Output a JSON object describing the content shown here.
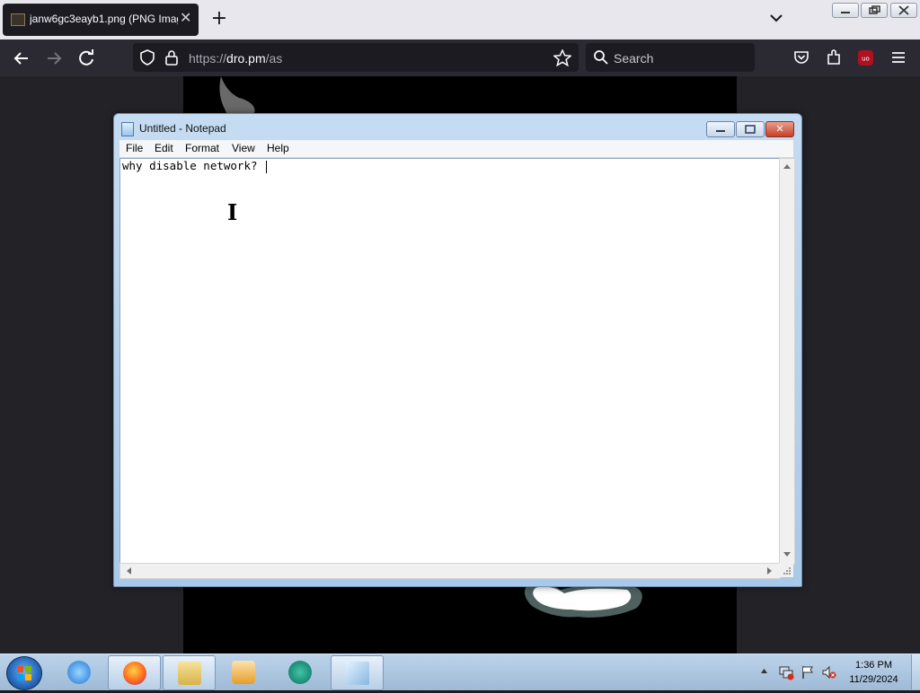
{
  "browser": {
    "tab_title": "janw6gc3eayb1.png (PNG Imag",
    "close_tab": "✕",
    "new_tab": "+",
    "url_prefix": "https://",
    "url_host": "dro.pm",
    "url_path": "/as",
    "search_placeholder": "Search"
  },
  "notepad": {
    "title": "Untitled - Notepad",
    "menu": [
      "File",
      "Edit",
      "Format",
      "View",
      "Help"
    ],
    "text": "why disable network?",
    "close_glyph": "✕"
  },
  "taskbar": {
    "time": "1:36 PM",
    "date": "11/29/2024"
  },
  "colors": {
    "browser_toolbar": "#2b2a33",
    "notepad_frame": "#a9c9ea",
    "taskbar": "#a8c2de"
  }
}
